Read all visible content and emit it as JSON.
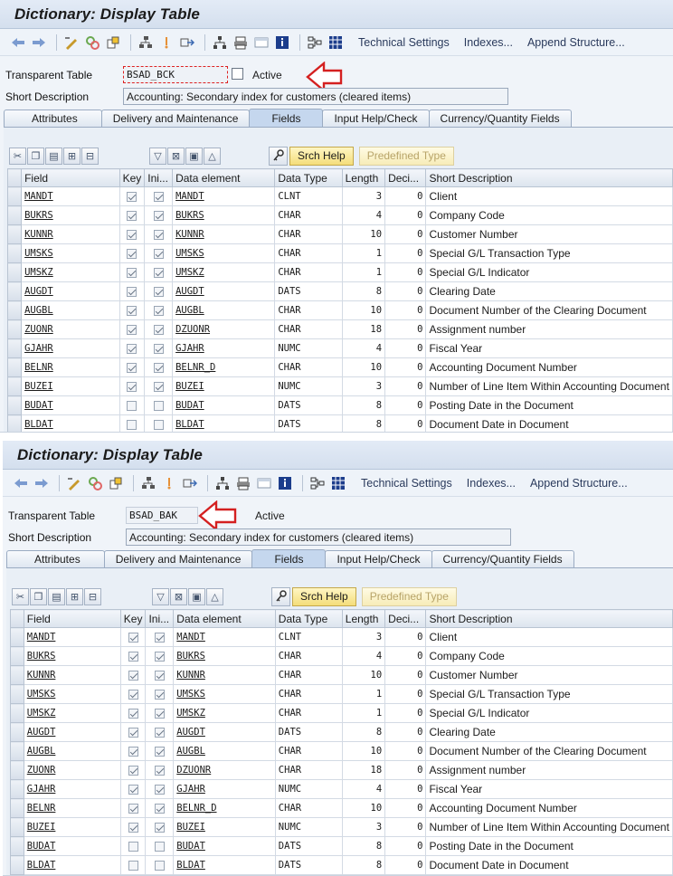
{
  "screens": [
    {
      "title": "Dictionary: Display Table",
      "toolbar": {
        "technical_settings": "Technical Settings",
        "indexes": "Indexes...",
        "append_structure": "Append Structure..."
      },
      "form": {
        "table_label": "Transparent Table",
        "table_value": "BSAD_BCK",
        "status": "Active",
        "desc_label": "Short Description",
        "desc_value": "Accounting: Secondary index for customers (cleared items)"
      },
      "tabs": [
        "Attributes",
        "Delivery and Maintenance",
        "Fields",
        "Input Help/Check",
        "Currency/Quantity Fields"
      ],
      "active_tab": "Fields",
      "buttons": {
        "srch_help": "Srch Help",
        "predefined_type": "Predefined Type"
      },
      "columns": [
        "Field",
        "Key",
        "Ini...",
        "Data element",
        "Data Type",
        "Length",
        "Deci...",
        "Short Description"
      ]
    },
    {
      "title": "Dictionary: Display Table",
      "toolbar": {
        "technical_settings": "Technical Settings",
        "indexes": "Indexes...",
        "append_structure": "Append Structure..."
      },
      "form": {
        "table_label": "Transparent Table",
        "table_value": "BSAD_BAK",
        "status": "Active",
        "desc_label": "Short Description",
        "desc_value": "Accounting: Secondary index for customers (cleared items)"
      },
      "tabs": [
        "Attributes",
        "Delivery and Maintenance",
        "Fields",
        "Input Help/Check",
        "Currency/Quantity Fields"
      ],
      "active_tab": "Fields",
      "buttons": {
        "srch_help": "Srch Help",
        "predefined_type": "Predefined Type"
      },
      "columns": [
        "Field",
        "Key",
        "Ini...",
        "Data element",
        "Data Type",
        "Length",
        "Deci...",
        "Short Description"
      ]
    }
  ],
  "rows": [
    {
      "field": "MANDT",
      "key": true,
      "init": true,
      "element": "MANDT",
      "type": "CLNT",
      "length": "3",
      "dec": "0",
      "desc": "Client"
    },
    {
      "field": "BUKRS",
      "key": true,
      "init": true,
      "element": "BUKRS",
      "type": "CHAR",
      "length": "4",
      "dec": "0",
      "desc": "Company Code"
    },
    {
      "field": "KUNNR",
      "key": true,
      "init": true,
      "element": "KUNNR",
      "type": "CHAR",
      "length": "10",
      "dec": "0",
      "desc": "Customer Number"
    },
    {
      "field": "UMSKS",
      "key": true,
      "init": true,
      "element": "UMSKS",
      "type": "CHAR",
      "length": "1",
      "dec": "0",
      "desc": "Special G/L Transaction Type"
    },
    {
      "field": "UMSKZ",
      "key": true,
      "init": true,
      "element": "UMSKZ",
      "type": "CHAR",
      "length": "1",
      "dec": "0",
      "desc": "Special G/L Indicator"
    },
    {
      "field": "AUGDT",
      "key": true,
      "init": true,
      "element": "AUGDT",
      "type": "DATS",
      "length": "8",
      "dec": "0",
      "desc": "Clearing Date"
    },
    {
      "field": "AUGBL",
      "key": true,
      "init": true,
      "element": "AUGBL",
      "type": "CHAR",
      "length": "10",
      "dec": "0",
      "desc": "Document Number of the Clearing Document"
    },
    {
      "field": "ZUONR",
      "key": true,
      "init": true,
      "element": "DZUONR",
      "type": "CHAR",
      "length": "18",
      "dec": "0",
      "desc": "Assignment number"
    },
    {
      "field": "GJAHR",
      "key": true,
      "init": true,
      "element": "GJAHR",
      "type": "NUMC",
      "length": "4",
      "dec": "0",
      "desc": "Fiscal Year"
    },
    {
      "field": "BELNR",
      "key": true,
      "init": true,
      "element": "BELNR_D",
      "type": "CHAR",
      "length": "10",
      "dec": "0",
      "desc": "Accounting Document Number"
    },
    {
      "field": "BUZEI",
      "key": true,
      "init": true,
      "element": "BUZEI",
      "type": "NUMC",
      "length": "3",
      "dec": "0",
      "desc": "Number of Line Item Within Accounting Document"
    },
    {
      "field": "BUDAT",
      "key": false,
      "init": false,
      "element": "BUDAT",
      "type": "DATS",
      "length": "8",
      "dec": "0",
      "desc": "Posting Date in the Document"
    },
    {
      "field": "BLDAT",
      "key": false,
      "init": false,
      "element": "BLDAT",
      "type": "DATS",
      "length": "8",
      "dec": "0",
      "desc": "Document Date in Document"
    }
  ],
  "colors": {
    "title_bg": "#d4dfee",
    "active_tab": "#c5d7ee",
    "arrow": "#d42020",
    "button_yellow": "#f4dd7a"
  }
}
